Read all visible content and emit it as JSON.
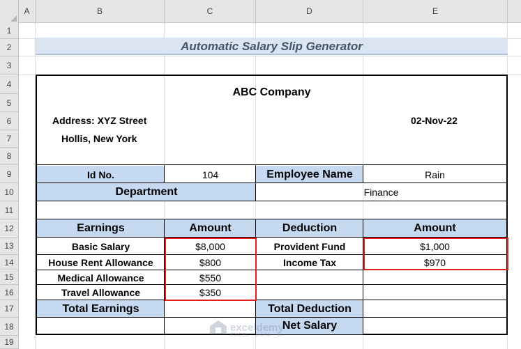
{
  "columns": [
    "A",
    "B",
    "C",
    "D",
    "E"
  ],
  "rows": [
    "1",
    "2",
    "3",
    "4",
    "5",
    "6",
    "7",
    "8",
    "9",
    "10",
    "11",
    "12",
    "13",
    "14",
    "15",
    "16",
    "17",
    "18",
    "19"
  ],
  "title": "Automatic Salary Slip Generator",
  "company": "ABC Company",
  "address_line1": "Address: XYZ  Street",
  "address_line2": "Hollis, New York",
  "date": "02-Nov-22",
  "id_label": "Id No.",
  "id_value": "104",
  "employee_name_label": "Employee Name",
  "employee_name_value": "Rain",
  "department_label": "Department",
  "department_value": "Finance",
  "earnings_header": "Earnings",
  "amount_header": "Amount",
  "deduction_header": "Deduction",
  "amount_header2": "Amount",
  "earnings": [
    {
      "label": "Basic Salary",
      "amount": "$8,000"
    },
    {
      "label": "House Rent Allowance",
      "amount": "$800"
    },
    {
      "label": "Medical Allowance",
      "amount": "$550"
    },
    {
      "label": "Travel Allowance",
      "amount": "$350"
    }
  ],
  "deductions": [
    {
      "label": "Provident Fund",
      "amount": "$1,000"
    },
    {
      "label": "Income Tax",
      "amount": "$970"
    }
  ],
  "total_earnings_label": "Total Earnings",
  "total_deduction_label": "Total Deduction",
  "net_salary_label": "Net Salary",
  "watermark": {
    "name": "exceldemy",
    "sub": "EXCEL · DATA · BI"
  },
  "colors": {
    "header_fill": "#c5d9f1",
    "title_fill": "#dbe5f1",
    "highlight_border": "#e0201f"
  }
}
